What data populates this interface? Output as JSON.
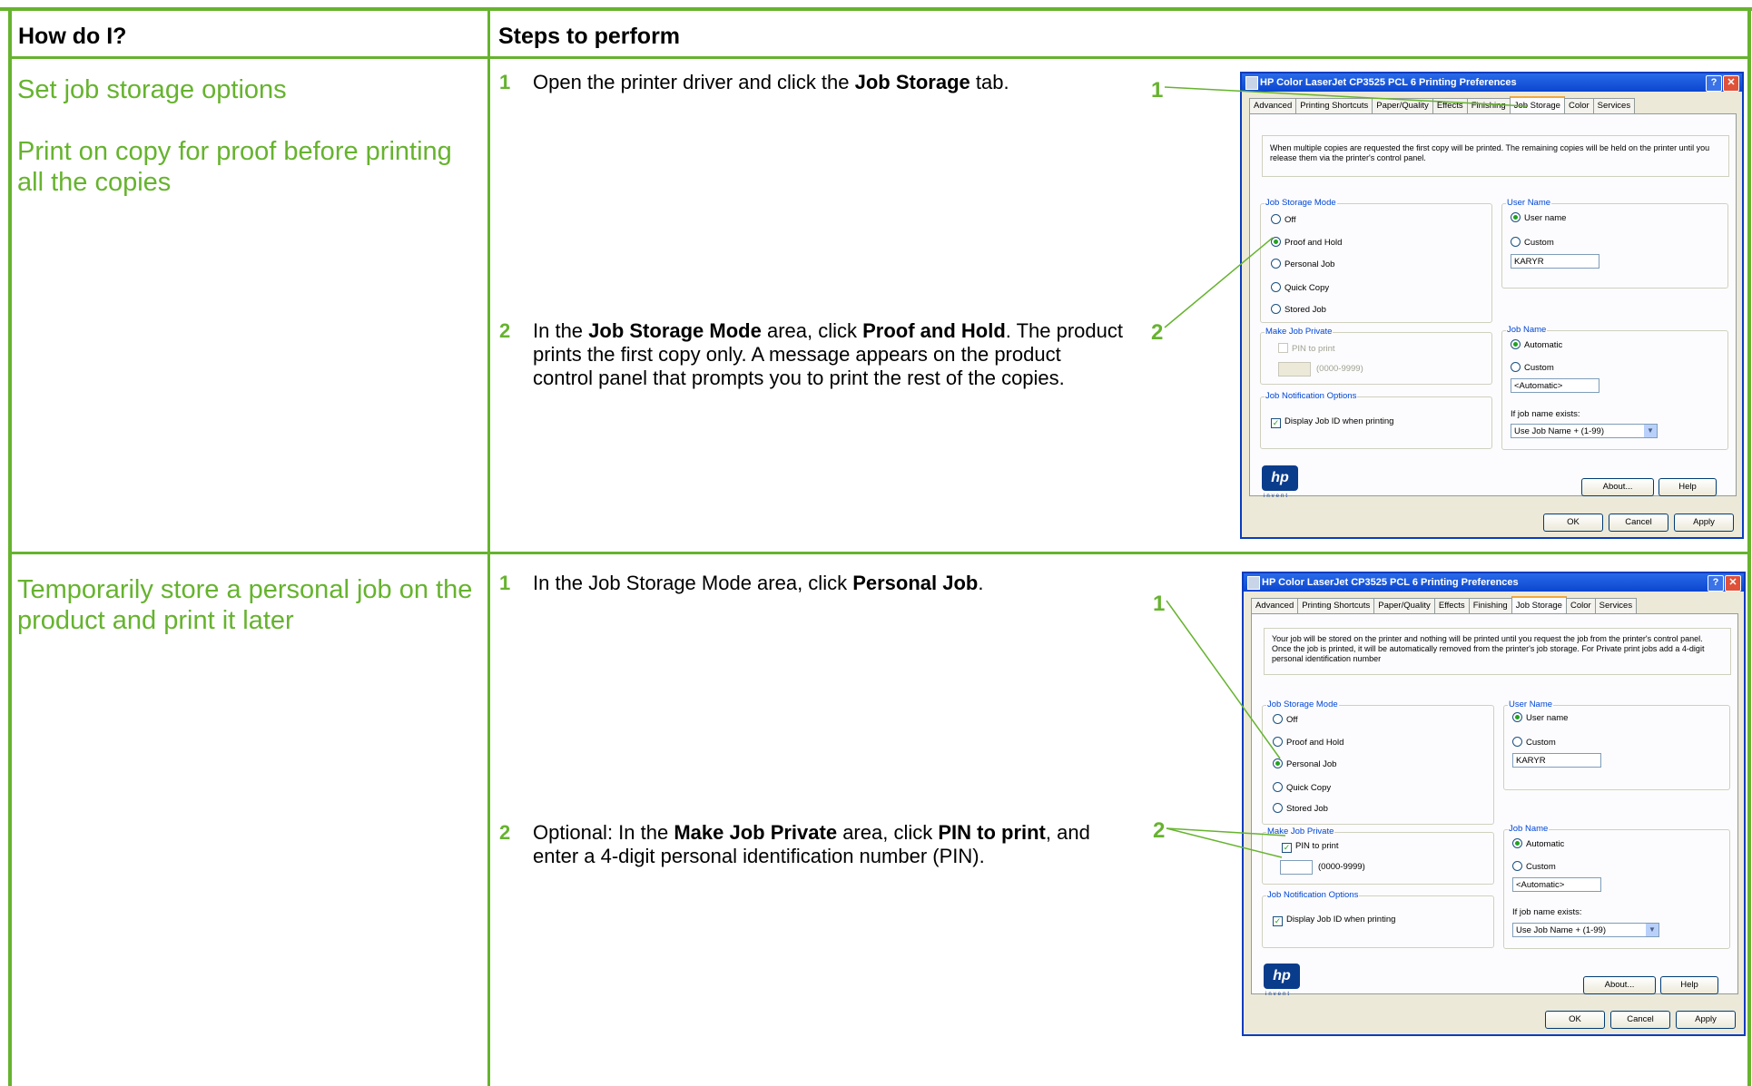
{
  "header": {
    "col1": "How do I?",
    "col2": "Steps to perform"
  },
  "row1": {
    "task1": "Set job storage options",
    "task2": "Print on copy for proof before printing all the copies",
    "step1_num": "1",
    "step1_pre": "Open the printer driver and click the ",
    "step1_bold": "Job Storage",
    "step1_post": " tab.",
    "step2_num": "2",
    "step2_a": "In the ",
    "step2_b": "Job Storage Mode",
    "step2_c": " area, click ",
    "step2_d": "Proof and Hold",
    "step2_e": ". The product prints the first copy only. A message appears on the product control panel that prompts you to print the rest of the copies.",
    "callout1": "1",
    "callout2": "2"
  },
  "row2": {
    "task": "Temporarily store a personal job on the product and print it later",
    "step1_num": "1",
    "step1_pre": "In the Job Storage Mode area, click ",
    "step1_bold": "Personal Job",
    "step1_post": ".",
    "step2_num": "2",
    "step2_a": "Optional: In the ",
    "step2_b": "Make Job Private",
    "step2_c": " area, click ",
    "step2_d": "PIN to print",
    "step2_e": ", and enter a 4-digit personal identification number (PIN).",
    "callout1": "1",
    "callout2": "2"
  },
  "dialog1": {
    "title": "HP Color LaserJet CP3525 PCL 6 Printing Preferences",
    "tabs": [
      "Advanced",
      "Printing Shortcuts",
      "Paper/Quality",
      "Effects",
      "Finishing",
      "Job Storage",
      "Color",
      "Services"
    ],
    "description": "When multiple copies are requested the first copy will be printed. The remaining copies will be held on the printer until you release them via the printer's control panel.",
    "mode_legend": "Job Storage Mode",
    "mode_options": [
      "Off",
      "Proof and Hold",
      "Personal Job",
      "Quick Copy",
      "Stored Job"
    ],
    "private_legend": "Make Job Private",
    "pin_label": "PIN to print",
    "pin_value": "",
    "pin_range": "(0000-9999)",
    "notify_legend": "Job Notification Options",
    "notify_label": "Display Job ID when printing",
    "user_legend": "User Name",
    "user_opt1": "User name",
    "user_opt2": "Custom",
    "user_value": "KARYR",
    "jobname_legend": "Job Name",
    "job_opt1": "Automatic",
    "job_opt2": "Custom",
    "job_value": "<Automatic>",
    "exists_label": "If job name exists:",
    "exists_value": "Use Job Name + (1-99)",
    "logo": "hp",
    "logo_sub": "invent",
    "about": "About...",
    "help": "Help",
    "ok": "OK",
    "cancel": "Cancel",
    "apply": "Apply"
  },
  "dialog2": {
    "title": "HP Color LaserJet CP3525 PCL 6 Printing Preferences",
    "tabs": [
      "Advanced",
      "Printing Shortcuts",
      "Paper/Quality",
      "Effects",
      "Finishing",
      "Job Storage",
      "Color",
      "Services"
    ],
    "description": "Your job will be stored on the printer and nothing will be printed until you request the job from the printer's control panel. Once the job is printed, it will be automatically removed from the printer's job storage. For Private print jobs add a 4-digit personal identification number",
    "mode_legend": "Job Storage Mode",
    "mode_options": [
      "Off",
      "Proof and Hold",
      "Personal Job",
      "Quick Copy",
      "Stored Job"
    ],
    "private_legend": "Make Job Private",
    "pin_label": "PIN to print",
    "pin_value": "",
    "pin_range": "(0000-9999)",
    "notify_legend": "Job Notification Options",
    "notify_label": "Display Job ID when printing",
    "user_legend": "User Name",
    "user_opt1": "User name",
    "user_opt2": "Custom",
    "user_value": "KARYR",
    "jobname_legend": "Job Name",
    "job_opt1": "Automatic",
    "job_opt2": "Custom",
    "job_value": "<Automatic>",
    "exists_label": "If job name exists:",
    "exists_value": "Use Job Name + (1-99)",
    "logo": "hp",
    "logo_sub": "invent",
    "about": "About...",
    "help": "Help",
    "ok": "OK",
    "cancel": "Cancel",
    "apply": "Apply"
  },
  "colors": {
    "accent": "#66b32e",
    "title_bar": "#0a46d0"
  }
}
